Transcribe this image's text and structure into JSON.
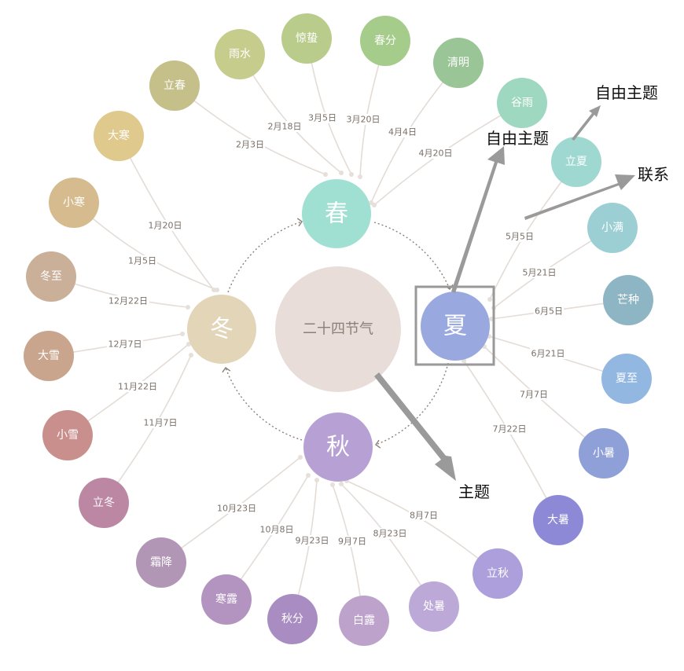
{
  "center": {
    "label": "二十四节气",
    "color": "#e8ddd8"
  },
  "seasons": [
    {
      "id": "spring",
      "label": "春",
      "color": "#9fe0d3"
    },
    {
      "id": "summer",
      "label": "夏",
      "color": "#9aa8e0"
    },
    {
      "id": "autumn",
      "label": "秋",
      "color": "#b7a0d4"
    },
    {
      "id": "winter",
      "label": "冬",
      "color": "#e2d5b8"
    }
  ],
  "terms": [
    {
      "name": "立春",
      "date": "2月3日",
      "season": "spring",
      "color": "#c5bf8a"
    },
    {
      "name": "雨水",
      "date": "2月18日",
      "season": "spring",
      "color": "#c6cc8c"
    },
    {
      "name": "惊蛰",
      "date": "3月5日",
      "season": "spring",
      "color": "#b9cc8b"
    },
    {
      "name": "春分",
      "date": "3月20日",
      "season": "spring",
      "color": "#a5cc8b"
    },
    {
      "name": "清明",
      "date": "4月4日",
      "season": "spring",
      "color": "#9ac597"
    },
    {
      "name": "谷雨",
      "date": "4月20日",
      "season": "spring",
      "color": "#9fd8c0"
    },
    {
      "name": "立夏",
      "date": "5月5日",
      "season": "summer",
      "color": "#9fd8d0"
    },
    {
      "name": "小满",
      "date": "5月21日",
      "season": "summer",
      "color": "#9ccfd4"
    },
    {
      "name": "芒种",
      "date": "6月5日",
      "season": "summer",
      "color": "#8eb5c4"
    },
    {
      "name": "夏至",
      "date": "6月21日",
      "season": "summer",
      "color": "#92b8e2"
    },
    {
      "name": "小暑",
      "date": "7月7日",
      "season": "summer",
      "color": "#8fa0d8"
    },
    {
      "name": "大暑",
      "date": "7月22日",
      "season": "summer",
      "color": "#8d89d6"
    },
    {
      "name": "立秋",
      "date": "8月7日",
      "season": "autumn",
      "color": "#ad9fdb"
    },
    {
      "name": "处暑",
      "date": "8月23日",
      "season": "autumn",
      "color": "#bca9d8"
    },
    {
      "name": "白露",
      "date": "9月7日",
      "season": "autumn",
      "color": "#bda2cc"
    },
    {
      "name": "秋分",
      "date": "9月23日",
      "season": "autumn",
      "color": "#a98dc2"
    },
    {
      "name": "寒露",
      "date": "10月8日",
      "season": "autumn",
      "color": "#b394c0"
    },
    {
      "name": "霜降",
      "date": "10月23日",
      "season": "autumn",
      "color": "#b196b5"
    },
    {
      "name": "立冬",
      "date": "11月7日",
      "season": "winter",
      "color": "#bb87a3"
    },
    {
      "name": "小雪",
      "date": "11月22日",
      "season": "winter",
      "color": "#c88f8d"
    },
    {
      "name": "大雪",
      "date": "12月7日",
      "season": "winter",
      "color": "#c9a58d"
    },
    {
      "name": "冬至",
      "date": "12月22日",
      "season": "winter",
      "color": "#cbb099"
    },
    {
      "name": "小寒",
      "date": "1月5日",
      "season": "winter",
      "color": "#d5bb8e"
    },
    {
      "name": "大寒",
      "date": "1月20日",
      "season": "winter",
      "color": "#e0c98d"
    }
  ],
  "callouts": {
    "free_topic_1": "自由主题",
    "free_topic_2": "自由主题",
    "relation": "联系",
    "topic": "主题",
    "arrow_color": "#9a9a9a",
    "selection_color": "#999999"
  }
}
